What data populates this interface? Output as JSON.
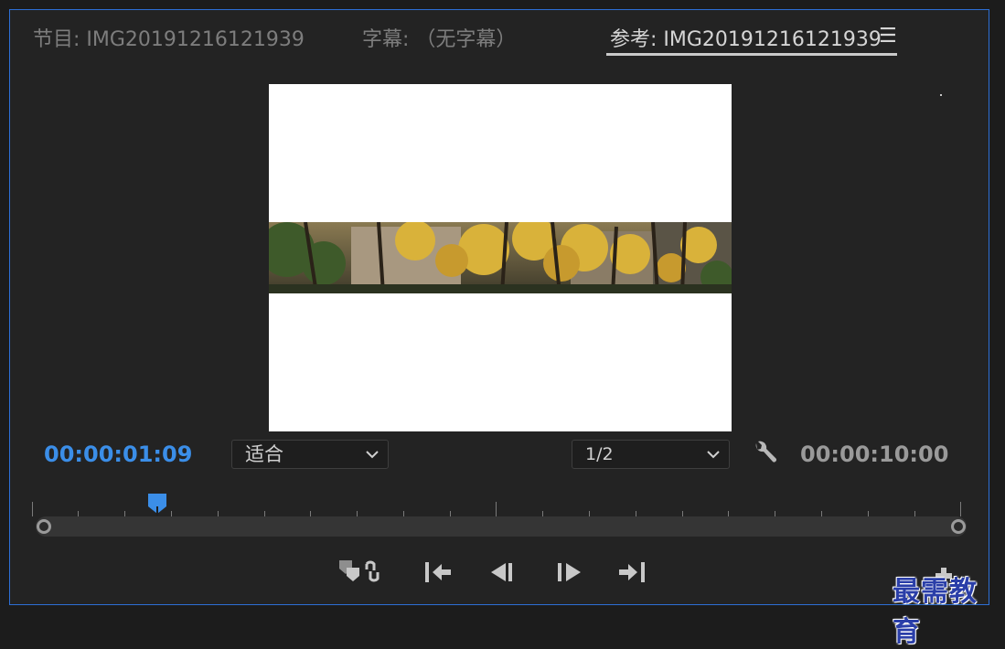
{
  "tabs": {
    "program": "节目: IMG20191216121939",
    "caption": "字幕: （无字幕）",
    "reference": "参考: IMG20191216121939",
    "menu_icon": "hamburger-menu-icon"
  },
  "viewer": {
    "content": "autumn-trees-building-photo"
  },
  "controls": {
    "current_timecode": "00:00:01:09",
    "zoom": "适合",
    "resolution": "1/2",
    "settings_icon": "wrench-icon",
    "duration_timecode": "00:00:10:00"
  },
  "timeline": {
    "playhead_position": 0.14
  },
  "transport": [
    "marker-link-icon",
    "go-to-in-icon",
    "step-back-icon",
    "step-forward-icon",
    "go-to-out-icon",
    "add-button-icon"
  ],
  "watermark": "最需教育",
  "colors": {
    "accent": "#3b8ee8",
    "panel_border": "#2d6fd6"
  }
}
